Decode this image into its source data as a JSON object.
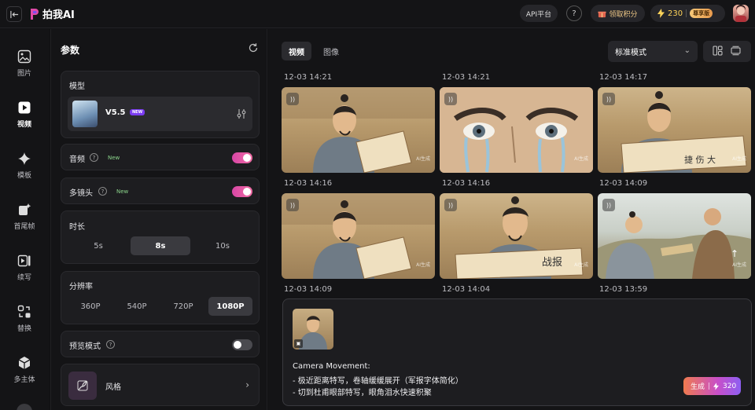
{
  "header": {
    "logo_text": "拍我AI",
    "api_label": "API平台",
    "help_label": "?",
    "points_label": "领取积分",
    "credits": "230",
    "vip_label": "尊享版"
  },
  "leftnav": {
    "items": [
      {
        "label": "图片",
        "icon": "image-icon"
      },
      {
        "label": "视频",
        "icon": "video-icon"
      },
      {
        "label": "模板",
        "icon": "sparkle-icon"
      },
      {
        "label": "首尾帧",
        "icon": "frame-icon"
      },
      {
        "label": "续写",
        "icon": "continue-icon"
      },
      {
        "label": "替换",
        "icon": "swap-icon"
      },
      {
        "label": "多主体",
        "icon": "cube-icon"
      }
    ]
  },
  "params": {
    "title": "参数",
    "model_label": "模型",
    "model_name": "V5.5",
    "model_badge": "NEW",
    "audio_label": "音频",
    "audio_new": "New",
    "multishot_label": "多镜头",
    "multishot_new": "New",
    "duration_label": "时长",
    "durations": [
      "5s",
      "8s",
      "10s"
    ],
    "duration_selected": "8s",
    "resolution_label": "分辨率",
    "resolutions": [
      "360P",
      "540P",
      "720P",
      "1080P"
    ],
    "resolution_selected": "1080P",
    "preview_label": "预览模式",
    "style_label": "风格",
    "audio_enabled": true,
    "multishot_enabled": true,
    "preview_enabled": false
  },
  "main": {
    "tabs": [
      "视频",
      "图像"
    ],
    "mode": "标准模式",
    "timestamps": [
      "12-03 14:21",
      "12-03 14:21",
      "12-03 14:17",
      "12-03 14:16",
      "12-03 14:16",
      "12-03 14:09",
      "12-03 14:09",
      "12-03 14:04",
      "12-03 13:59"
    ],
    "watermark": "AI生成",
    "prompt": {
      "line1": "Camera Movement:",
      "line2": "- 极近距离特写，卷轴缓缓展开（军报字体简化）",
      "line3": "- 切到杜甫眼部特写，眼角泪水快速积聚",
      "generate_label": "生成",
      "cost": "320"
    }
  }
}
